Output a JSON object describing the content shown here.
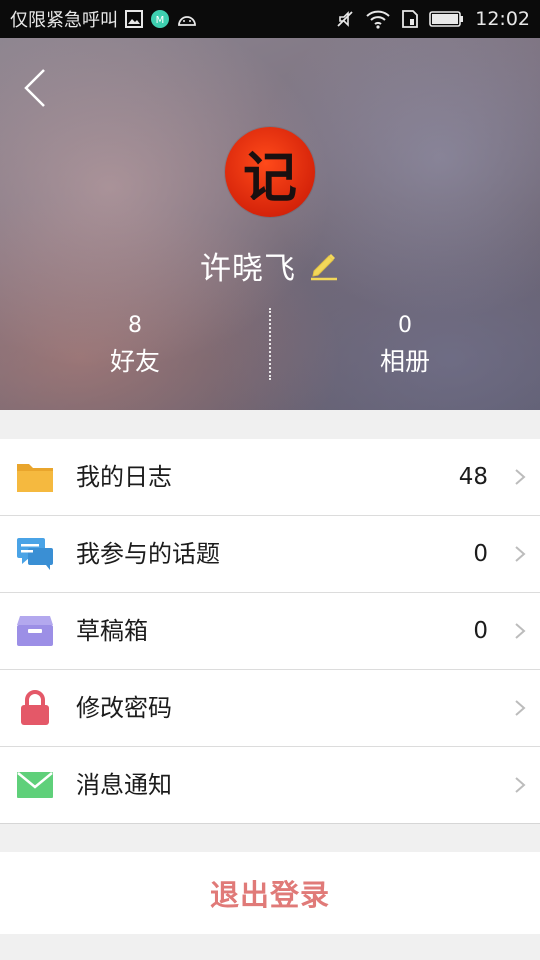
{
  "status_bar": {
    "carrier": "仅限紧急呼叫",
    "time": "12:02"
  },
  "profile": {
    "avatar_char": "记",
    "name": "许晓飞",
    "stats": [
      {
        "value": "8",
        "label": "好友"
      },
      {
        "value": "0",
        "label": "相册"
      }
    ]
  },
  "menu": {
    "items": [
      {
        "label": "我的日志",
        "count": "48",
        "icon": "folder-icon"
      },
      {
        "label": "我参与的话题",
        "count": "0",
        "icon": "chat-bubbles-icon"
      },
      {
        "label": "草稿箱",
        "count": "0",
        "icon": "inbox-tray-icon"
      },
      {
        "label": "修改密码",
        "count": "",
        "icon": "lock-icon"
      },
      {
        "label": "消息通知",
        "count": "",
        "icon": "envelope-icon"
      }
    ]
  },
  "logout_label": "退出登录",
  "colors": {
    "logout_text": "#e07a78",
    "folder": "#f5b93f",
    "chat": "#4aa3e6",
    "tray": "#9c8fe6",
    "lock": "#e45868",
    "envelope": "#5fd07a",
    "avatar": "#e0300e"
  }
}
